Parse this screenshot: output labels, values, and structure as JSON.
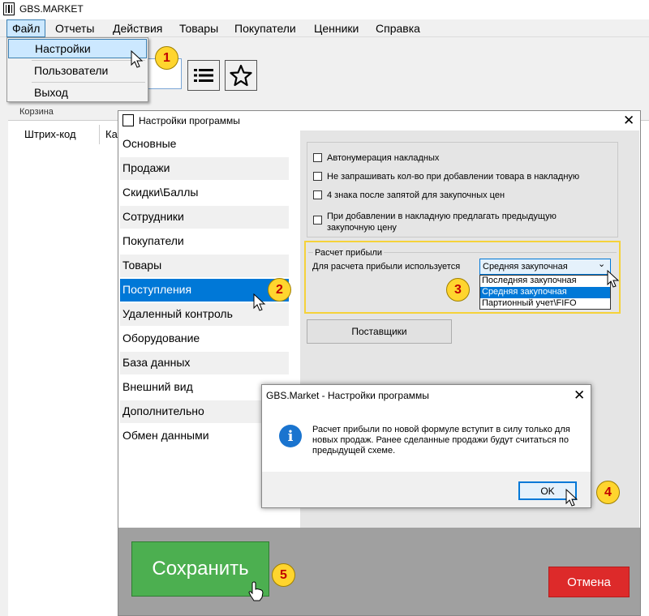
{
  "app": {
    "title": "GBS.MARKET",
    "menu": [
      "Файл",
      "Отчеты",
      "Действия",
      "Товары",
      "Покупатели",
      "Ценники",
      "Справка"
    ],
    "file_menu": {
      "settings": "Настройки",
      "users": "Пользователи",
      "exit": "Выход"
    },
    "toolbar_icons": [
      "list-icon",
      "star-icon"
    ],
    "basket": {
      "label": "Корзина",
      "columns": [
        "Штрих-код",
        "Ка"
      ]
    }
  },
  "settings_window": {
    "title": "Настройки программы",
    "sidebar": [
      "Основные",
      "Продажи",
      "Скидки\\Баллы",
      "Сотрудники",
      "Покупатели",
      "Товары",
      "Поступления",
      "Удаленный контроль",
      "Оборудование",
      "База данных",
      "Внешний вид",
      "Дополнительно",
      "Обмен данными"
    ],
    "active_section": "Поступления",
    "checkboxes": [
      "Автонумерация накладных",
      "Не запрашивать кол-во при добавлении товара в накладную",
      "4 знака после запятой для закупочных цен",
      "При добавлении в накладную предлагать предыдущую закупочную цену"
    ],
    "profit": {
      "group_label": "Расчет прибыли",
      "field_label": "Для расчета прибыли используется",
      "selected": "Средняя закупочная",
      "options": [
        "Последняя закупочная",
        "Средняя закупочная",
        "Партионный учет\\FIFO"
      ]
    },
    "suppliers_button": "Поставщики",
    "save_button": "Сохранить",
    "cancel_button": "Отмена"
  },
  "message_box": {
    "title": "GBS.Market - Настройки программы",
    "text": "Расчет прибыли по новой формуле вступит в силу только для новых продаж. Ранее сделанные продажи будут считаться по предыдущей схеме.",
    "ok_button": "OK"
  },
  "step_badges": [
    "1",
    "2",
    "3",
    "4",
    "5"
  ],
  "colors": {
    "selection_blue": "#0078d7",
    "menu_highlight": "#cce8ff",
    "save_green": "#4caf50",
    "cancel_red": "#dd2a2a",
    "badge_yellow": "#ffd52e",
    "badge_text": "#c00000",
    "highlight_frame": "#f5d23a"
  }
}
